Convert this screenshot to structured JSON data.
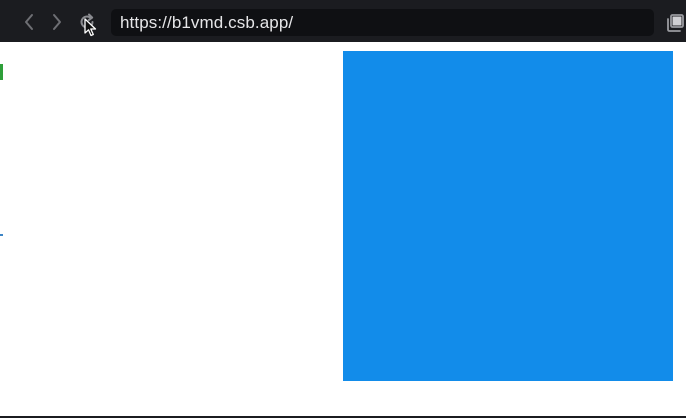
{
  "browser": {
    "url": "https://b1vmd.csb.app/",
    "icons": {
      "back": "chevron-left-icon",
      "forward": "chevron-right-icon",
      "reload": "reload-icon",
      "tabs": "tabs-icon",
      "cursor": "mouse-pointer-icon"
    }
  },
  "page": {
    "box_color": "#128cea",
    "background": "#ffffff"
  },
  "colors": {
    "toolbar_bg": "#1b1c20",
    "url_bar_bg": "#0f1013",
    "url_text": "#e6e6e8",
    "icon_color": "#8a8b90"
  }
}
